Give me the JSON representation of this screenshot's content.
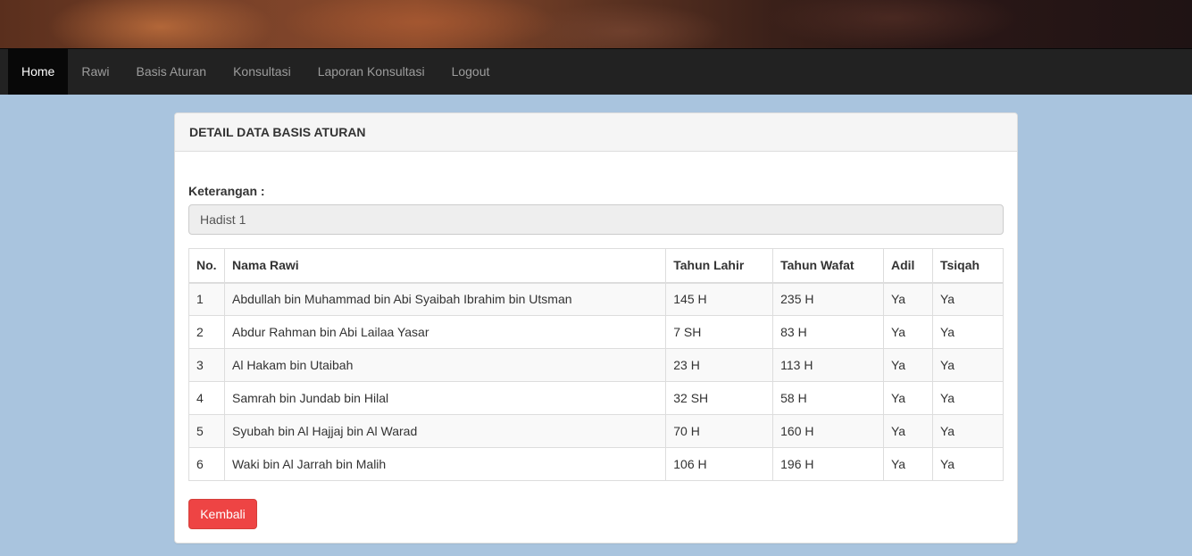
{
  "nav": {
    "items": [
      {
        "label": "Home",
        "active": true
      },
      {
        "label": "Rawi",
        "active": false
      },
      {
        "label": "Basis Aturan",
        "active": false
      },
      {
        "label": "Konsultasi",
        "active": false
      },
      {
        "label": "Laporan Konsultasi",
        "active": false
      },
      {
        "label": "Logout",
        "active": false
      }
    ]
  },
  "panel": {
    "title": "DETAIL DATA BASIS ATURAN",
    "keterangan_label": "Keterangan :",
    "keterangan_value": "Hadist 1",
    "back_label": "Kembali"
  },
  "table": {
    "headers": [
      "No.",
      "Nama Rawi",
      "Tahun Lahir",
      "Tahun Wafat",
      "Adil",
      "Tsiqah"
    ],
    "rows": [
      [
        "1",
        "Abdullah bin Muhammad bin Abi Syaibah Ibrahim bin Utsman",
        "145 H",
        "235 H",
        "Ya",
        "Ya"
      ],
      [
        "2",
        "Abdur Rahman bin Abi Lailaa Yasar",
        "7 SH",
        "83 H",
        "Ya",
        "Ya"
      ],
      [
        "3",
        "Al Hakam bin Utaibah",
        "23 H",
        "113 H",
        "Ya",
        "Ya"
      ],
      [
        "4",
        "Samrah bin Jundab bin Hilal",
        "32 SH",
        "58 H",
        "Ya",
        "Ya"
      ],
      [
        "5",
        "Syubah bin Al Hajjaj bin Al Warad",
        "70 H",
        "160 H",
        "Ya",
        "Ya"
      ],
      [
        "6",
        "Waki bin Al Jarrah bin Malih",
        "106 H",
        "196 H",
        "Ya",
        "Ya"
      ]
    ]
  },
  "colors": {
    "page_background": "#a9c4de",
    "navbar": "#222222",
    "button_danger": "#ee4444"
  }
}
